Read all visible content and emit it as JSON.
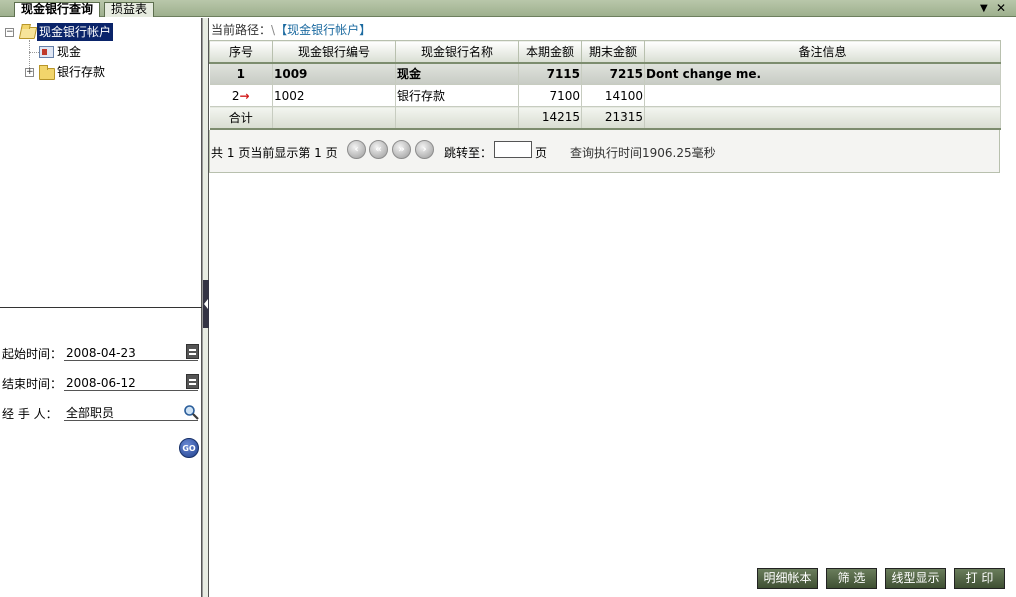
{
  "tabs": [
    {
      "label": "现金银行查询",
      "active": true
    },
    {
      "label": "损益表",
      "active": false
    }
  ],
  "tab_controls": {
    "menu": "▼",
    "close": "✕"
  },
  "tree": {
    "root": {
      "label": "现金银行帐户",
      "expander": "−"
    },
    "children": [
      {
        "label": "现金",
        "expander": ""
      },
      {
        "label": "银行存款",
        "expander": "+"
      }
    ]
  },
  "filters": {
    "start_label": "起始时间：",
    "start_value": "2008-04-23",
    "end_label": "结束时间：",
    "end_value": "2008-06-12",
    "handler_label": "经 手 人：",
    "handler_value": "全部职员",
    "go_label": "GO"
  },
  "breadcrumb": {
    "prefix": "当前路径：",
    "separator": "\\",
    "path": "【现金银行帐户】"
  },
  "table": {
    "columns": [
      "序号",
      "现金银行编号",
      "现金银行名称",
      "本期金额",
      "期末金额",
      "备注信息"
    ],
    "rows": [
      {
        "seq": "1",
        "marker": "",
        "code": "1009",
        "name": "现金",
        "current": "7115",
        "ending": "7215",
        "note": "Dont change me."
      },
      {
        "seq": "2",
        "marker": "→",
        "code": "1002",
        "name": "银行存款",
        "current": "7100",
        "ending": "14100",
        "note": ""
      }
    ],
    "total": {
      "label": "合计",
      "current": "14215",
      "ending": "21315"
    }
  },
  "pager": {
    "total_text": "共",
    "total_pages": "1",
    "page_unit": "页",
    "current_text": "当前显示第",
    "current_page": "1",
    "btn_first": "‹",
    "btn_prev": "«",
    "btn_next": "»",
    "btn_last": "›",
    "jump_label": "跳转至：",
    "jump_value": "",
    "jump_unit": "页",
    "query_time": "查询执行时间1906.25毫秒"
  },
  "buttons": {
    "detail": "明细帐本",
    "filter": "筛 选",
    "chart": "线型显示",
    "print": "打 印"
  }
}
